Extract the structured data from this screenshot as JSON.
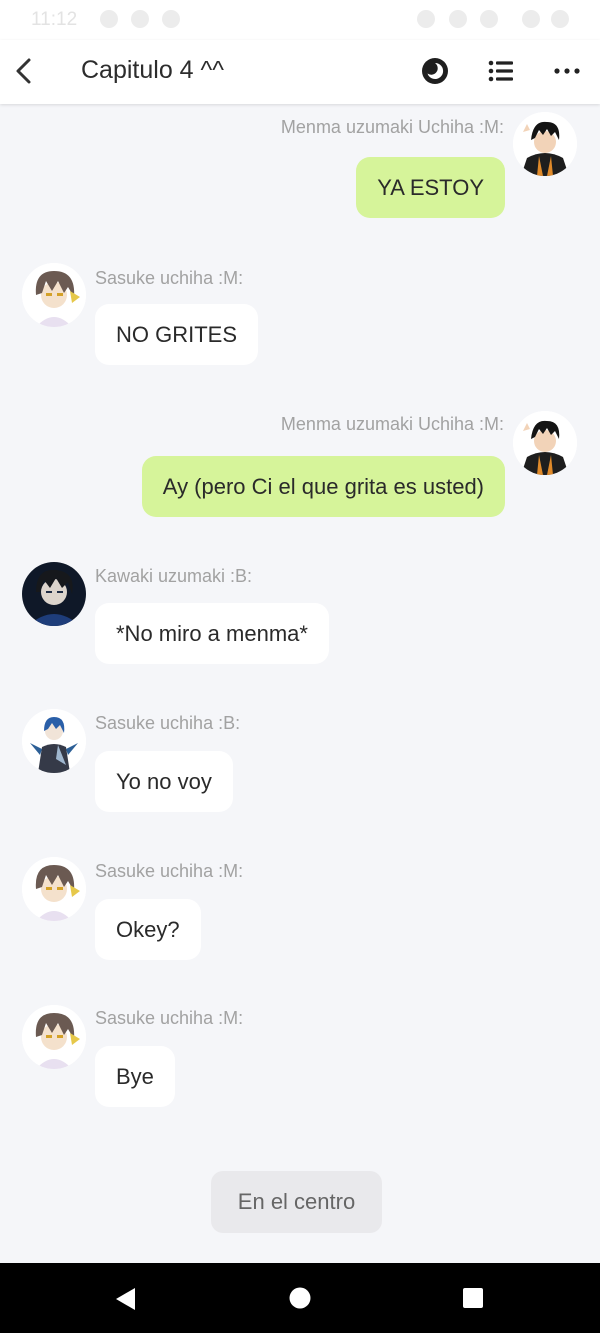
{
  "status_bar": {
    "time": "11:12"
  },
  "header": {
    "title": "Capitulo 4 ^^",
    "back_icon": "chevron-left-icon",
    "night_icon": "moon-toggle-icon",
    "list_icon": "list-icon",
    "more_icon": "more-horizontal-icon"
  },
  "messages": [
    {
      "sender": "Menma uzumaki Uchiha :M:",
      "text": "YA ESTOY",
      "side": "right",
      "avatar": "boy-dark-hair-orange-jacket"
    },
    {
      "sender": "Sasuke uchiha :M:",
      "text": "NO GRITES",
      "side": "left",
      "avatar": "anime-boy-light"
    },
    {
      "sender": "Menma uzumaki Uchiha :M:",
      "text": "Ay (pero Ci el que grita es usted)",
      "side": "right",
      "avatar": "boy-dark-hair-orange-jacket"
    },
    {
      "sender": "Kawaki uzumaki :B:",
      "text": "*No miro a menma*",
      "side": "left",
      "avatar": "anime-boy-dark-blue"
    },
    {
      "sender": "Sasuke uchiha :B:",
      "text": "Yo no voy",
      "side": "left",
      "avatar": "anime-boy-blue-coat"
    },
    {
      "sender": "Sasuke uchiha :M:",
      "text": "Okey?",
      "side": "left",
      "avatar": "anime-boy-light"
    },
    {
      "sender": "Sasuke uchiha :M:",
      "text": "Bye",
      "side": "left",
      "avatar": "anime-boy-light"
    }
  ],
  "center_button": {
    "label": "En el centro"
  },
  "nav_bar": {
    "back_icon": "nav-back-icon",
    "home_icon": "nav-home-icon",
    "recents_icon": "nav-recents-icon"
  },
  "colors": {
    "outgoing_bubble": "#d6f49a",
    "incoming_bubble": "#ffffff",
    "background": "#f5f6f9"
  }
}
